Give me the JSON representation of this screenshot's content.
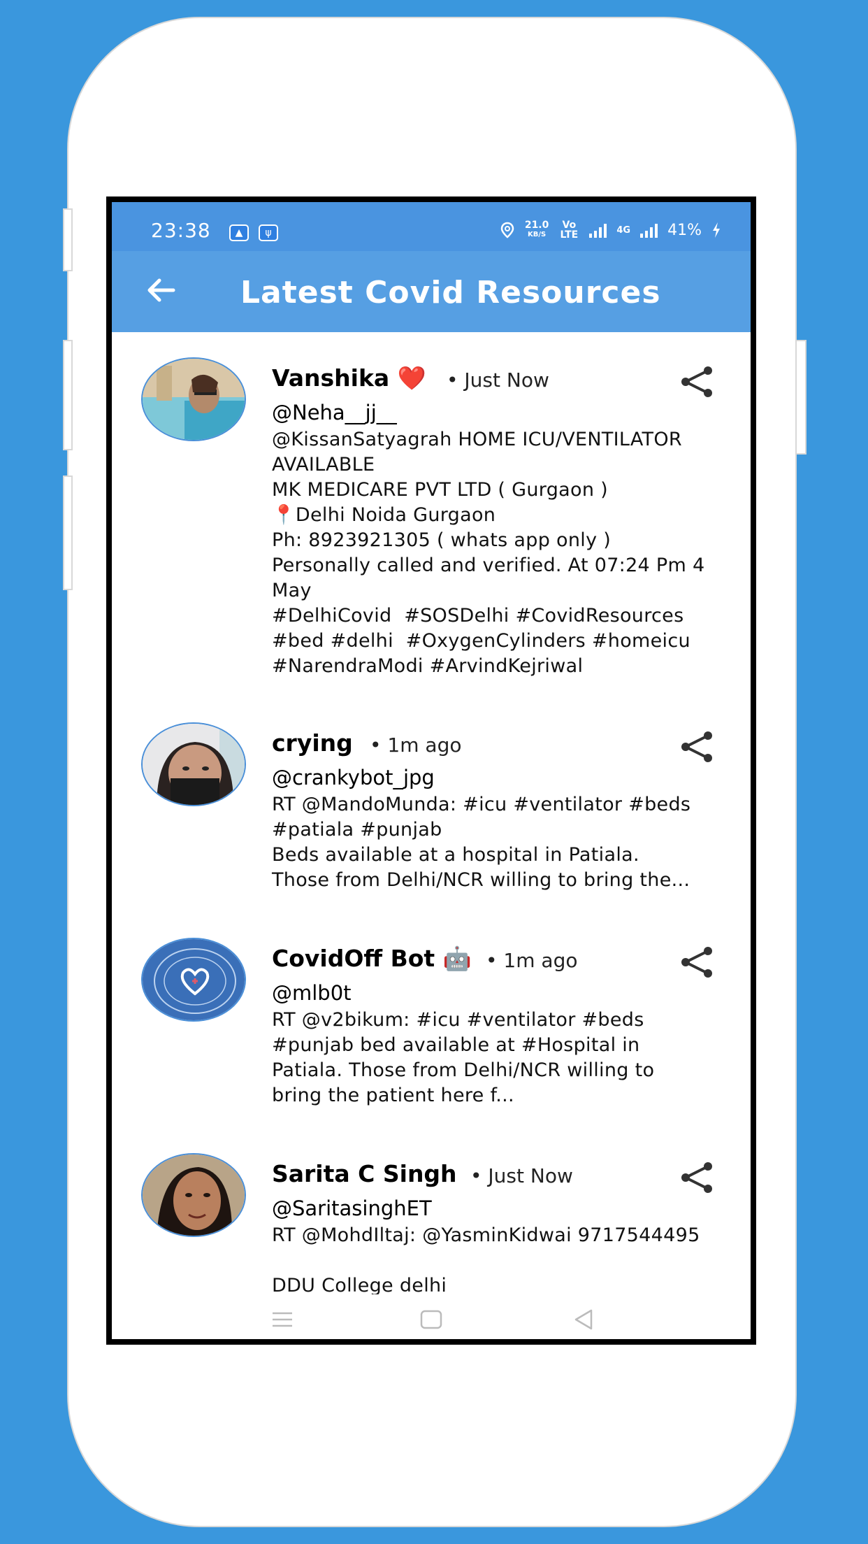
{
  "colors": {
    "background": "#3a97dd",
    "statusbar": "#4a94e0",
    "appbar": "#569fe3"
  },
  "status_bar": {
    "time": "23:38",
    "speed_value": "21.0",
    "speed_unit": "KB/S",
    "volte": "Vo LTE",
    "network": "4G",
    "battery": "41%"
  },
  "app_bar": {
    "title": "Latest Covid Resources",
    "back_icon": "arrow-left-icon"
  },
  "posts": [
    {
      "name": "Vanshika ❤️",
      "time": "• Just Now",
      "handle": "@Neha__jj__",
      "text": "@KissanSatyagrah HOME ICU/VENTILATOR\nAVAILABLE\nMK MEDICARE PVT LTD ( Gurgaon )\n📍Delhi Noida Gurgaon\nPh: 8923921305 ( whats app only )\nPersonally called and verified. At 07:24 Pm 4\nMay\n#DelhiCovid  #SOSDelhi #CovidResources\n#bed #delhi  #OxygenCylinders #homeicu\n#NarendraModi #ArvindKejriwal"
    },
    {
      "name": "crying",
      "time": "• 1m ago",
      "handle": "@crankybot_jpg",
      "text": "RT @MandoMunda: #icu #ventilator #beds\n#patiala #punjab\nBeds available at a hospital in Patiala.\nThose from Delhi/NCR willing to bring the..."
    },
    {
      "name": "CovidOff Bot 🤖",
      "time": "• 1m ago",
      "handle": "@mlb0t",
      "text": "RT @v2bikum: #icu #ventilator #beds\n#punjab bed available at #Hospital in\nPatiala. Those from Delhi/NCR willing to\nbring the patient here f..."
    },
    {
      "name": "Sarita C Singh",
      "time": "• Just Now",
      "handle": "@SaritasinghET",
      "text": "RT @MohdIltaj: @YasminKidwai 9717544495\n\nDDU College delhi"
    }
  ],
  "nav": {
    "menu_icon": "menu-icon",
    "home_icon": "home-square-icon",
    "back_icon": "back-triangle-icon"
  }
}
